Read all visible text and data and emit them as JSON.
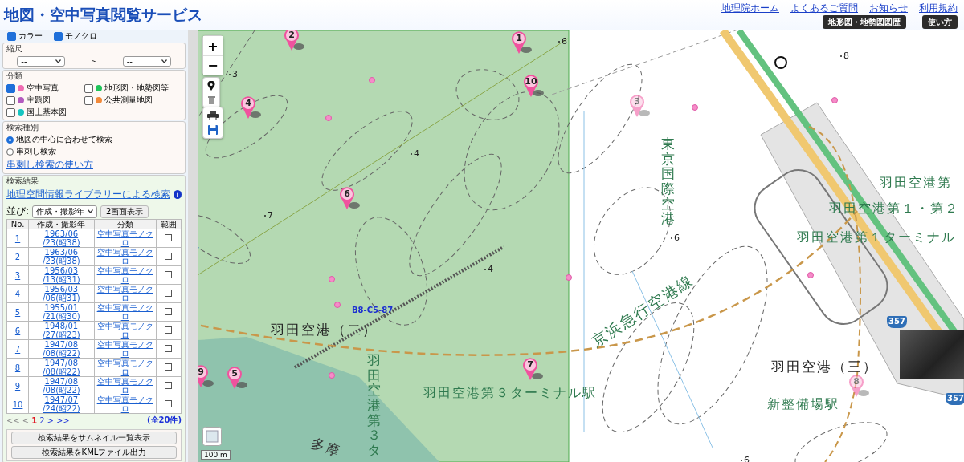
{
  "header": {
    "title": "地図・空中写真閲覧サービス",
    "links": [
      "地理院ホーム",
      "よくあるご質問",
      "お知らせ",
      "利用規約"
    ],
    "buttons": [
      "地形図・地勢図図歴",
      "使い方"
    ]
  },
  "filters": {
    "photo_types": [
      {
        "label": "カラー",
        "checked": true
      },
      {
        "label": "モノクロ",
        "checked": true
      }
    ],
    "scale": {
      "label": "縮尺",
      "from": "--",
      "separator": "～",
      "to": "--"
    },
    "category": {
      "label": "分類",
      "items": [
        {
          "label": "空中写真",
          "checked": true,
          "color": "#f06cb2"
        },
        {
          "label": "地形図・地勢図等",
          "checked": false,
          "color": "#1fc45a"
        },
        {
          "label": "主題図",
          "checked": false,
          "color": "#b35bbf"
        },
        {
          "label": "公共測量地図",
          "checked": false,
          "color": "#f28a3a"
        },
        {
          "label": "国土基本図",
          "checked": false,
          "color": "#17c4c0"
        }
      ]
    },
    "search_type": {
      "label": "検索種別",
      "options": [
        {
          "label": "地図の中心に合わせて検索",
          "selected": true
        },
        {
          "label": "串刺し検索",
          "selected": false
        }
      ],
      "help_link": "串刺し検索の使い方"
    }
  },
  "results": {
    "label": "検索結果",
    "library_link": "地理空間情報ライブラリーによる検索",
    "info_icon": "i",
    "sort_label": "並び:",
    "sort_value": "作成・撮影年",
    "dual_button": "2画面表示",
    "columns": [
      "No.",
      "作成・撮影年",
      "分類",
      "範囲"
    ],
    "rows": [
      {
        "no": "1",
        "date": "1963/06\n/23(昭38)",
        "category": "空中写真モノクロ",
        "range": false
      },
      {
        "no": "2",
        "date": "1963/06\n/23(昭38)",
        "category": "空中写真モノクロ",
        "range": false
      },
      {
        "no": "3",
        "date": "1956/03\n/13(昭31)",
        "category": "空中写真モノクロ",
        "range": false
      },
      {
        "no": "4",
        "date": "1956/03\n/06(昭31)",
        "category": "空中写真モノクロ",
        "range": false
      },
      {
        "no": "5",
        "date": "1955/01\n/21(昭30)",
        "category": "空中写真モノクロ",
        "range": false
      },
      {
        "no": "6",
        "date": "1948/01\n/27(昭23)",
        "category": "空中写真モノクロ",
        "range": false
      },
      {
        "no": "7",
        "date": "1947/08\n/08(昭22)",
        "category": "空中写真モノクロ",
        "range": false
      },
      {
        "no": "8",
        "date": "1947/08\n/08(昭22)",
        "category": "空中写真モノクロ",
        "range": false
      },
      {
        "no": "9",
        "date": "1947/08\n/08(昭22)",
        "category": "空中写真モノクロ",
        "range": false
      },
      {
        "no": "10",
        "date": "1947/07\n/24(昭22)",
        "category": "空中写真モノクロ",
        "range": false
      }
    ],
    "pagination": {
      "first": "<<",
      "prev": "<",
      "pages": [
        {
          "label": "1",
          "selected": true
        },
        {
          "label": "2",
          "selected": false
        }
      ],
      "next": ">",
      "last": ">>",
      "total": "(全20件)"
    },
    "buttons": [
      "検索結果をサムネイル一覧表示",
      "検索結果をKMLファイル出力"
    ]
  },
  "map": {
    "zoom_in": "+",
    "zoom_out": "−",
    "pins": [
      {
        "label": "1",
        "dimmed": false
      },
      {
        "label": "2",
        "dimmed": false
      },
      {
        "label": "3",
        "dimmed": true
      },
      {
        "label": "4",
        "dimmed": false
      },
      {
        "label": "5",
        "dimmed": false
      },
      {
        "label": "6",
        "dimmed": false
      },
      {
        "label": "7",
        "dimmed": false
      },
      {
        "label": "8",
        "dimmed": true
      },
      {
        "label": "9",
        "dimmed": false
      },
      {
        "label": "10",
        "dimmed": false
      }
    ],
    "labels": [
      {
        "text": "B8-C5-87",
        "kind": "code"
      },
      {
        "text": "羽田空港（二）",
        "kind": "place"
      },
      {
        "text": "羽田空港第３ターミナル駅",
        "kind": "station"
      },
      {
        "text": "京浜急行空港線",
        "kind": "railway"
      },
      {
        "text": "東京国際空港",
        "kind": "vertical"
      },
      {
        "text": "羽田空港第",
        "kind": "station"
      },
      {
        "text": "羽田空港第１・第２",
        "kind": "station"
      },
      {
        "text": "羽田空港第１ターミナル",
        "kind": "station"
      },
      {
        "text": "羽田空港（三）",
        "kind": "place"
      },
      {
        "text": "新整備場駅",
        "kind": "station"
      },
      {
        "text": "羽田空港第３タ",
        "kind": "vertical"
      },
      {
        "text": "多摩",
        "kind": "river"
      }
    ],
    "spot_heights": [
      "3",
      "4",
      "7",
      "6",
      "6",
      "4",
      "8",
      "6"
    ],
    "route_shields": [
      "357",
      "357"
    ],
    "scale": "100 m"
  }
}
